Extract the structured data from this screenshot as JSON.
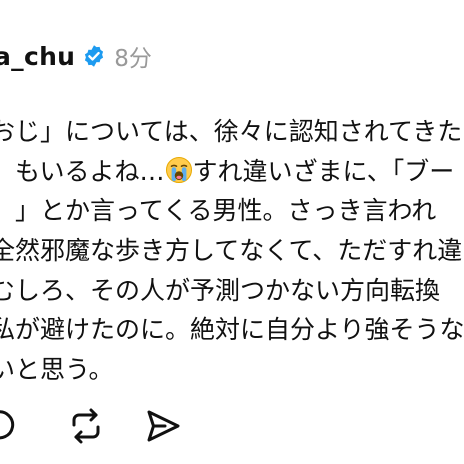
{
  "post": {
    "username": "a_chu",
    "timestamp": "8分",
    "body_lines": [
      "おじ」については、徐々に認知されてきた",
      "」もいるよね…",
      "！」とか言ってくる男性。さっき言われ",
      "全然邪魔な歩き方してなくて、ただすれ違",
      "むしろ、その人が予測つかない方向転換",
      "私が避けたのに。絶対に自分より強そうな",
      "いと思う。"
    ],
    "line2_suffix": "すれ違いざまに、「ブー",
    "emoji": "loudly-crying-face",
    "accent_color": "#1d9bf0"
  },
  "actions": [
    {
      "name": "comment-button",
      "icon": "speech-bubble-icon"
    },
    {
      "name": "repost-button",
      "icon": "repost-icon"
    },
    {
      "name": "share-button",
      "icon": "send-icon"
    }
  ]
}
